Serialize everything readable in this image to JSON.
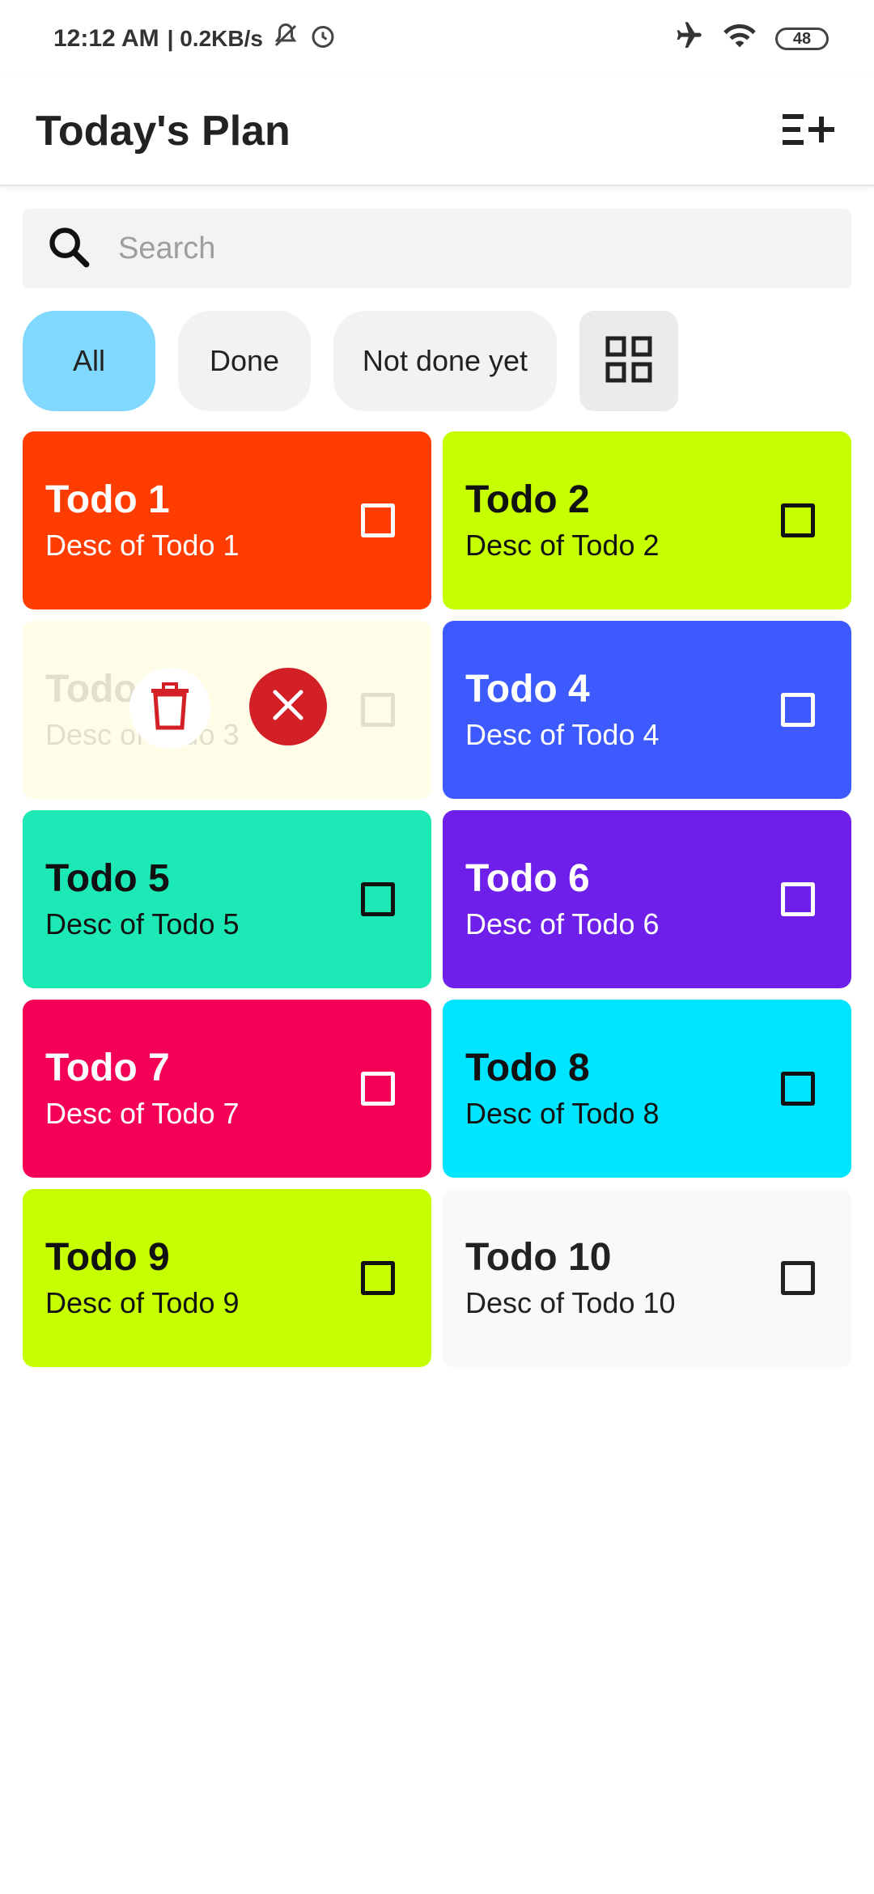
{
  "status_bar": {
    "time": "12:12 AM",
    "speed": "| 0.2KB/s",
    "battery": "48",
    "icons": [
      "mute-bell-icon",
      "alarm-icon",
      "airplane-icon",
      "wifi-icon",
      "battery-icon"
    ]
  },
  "appbar": {
    "title": "Today's Plan",
    "action_icon": "playlist-add-icon"
  },
  "search": {
    "placeholder": "Search",
    "value": ""
  },
  "filters": {
    "chips": [
      {
        "label": "All",
        "active": true
      },
      {
        "label": "Done",
        "active": false
      },
      {
        "label": "Not done yet",
        "active": false
      }
    ],
    "view_toggle_icon": "grid-view-icon"
  },
  "todos": [
    {
      "title": "Todo 1",
      "desc": "Desc of Todo 1",
      "color": "#ff3d00",
      "text_color": "#ffffff",
      "check_color": "#ffffff",
      "checked": false
    },
    {
      "title": "Todo 2",
      "desc": "Desc of Todo 2",
      "color": "#c6ff00",
      "text_color": "#111111",
      "check_color": "#111111",
      "checked": false
    },
    {
      "title": "Todo 3",
      "desc": "Desc of Todo 3",
      "color": "#fffde7",
      "text_color": "#111111",
      "check_color": "#111111",
      "checked": false,
      "selected": true
    },
    {
      "title": "Todo 4",
      "desc": "Desc of Todo 4",
      "color": "#3d5afe",
      "text_color": "#ffffff",
      "check_color": "#ffffff",
      "checked": false
    },
    {
      "title": "Todo 5",
      "desc": "Desc of Todo 5",
      "color": "#1de9b6",
      "text_color": "#111111",
      "check_color": "#111111",
      "checked": false
    },
    {
      "title": "Todo 6",
      "desc": "Desc of Todo 6",
      "color": "#6e20ea",
      "text_color": "#ffffff",
      "check_color": "#ffffff",
      "checked": false
    },
    {
      "title": "Todo 7",
      "desc": "Desc of Todo 7",
      "color": "#f50057",
      "text_color": "#ffffff",
      "check_color": "#ffffff",
      "checked": false
    },
    {
      "title": "Todo 8",
      "desc": "Desc of Todo 8",
      "color": "#00e5ff",
      "text_color": "#111111",
      "check_color": "#111111",
      "checked": false
    },
    {
      "title": "Todo 9",
      "desc": "Desc of Todo 9",
      "color": "#c6ff00",
      "text_color": "#111111",
      "check_color": "#111111",
      "checked": false
    },
    {
      "title": "Todo 10",
      "desc": "Desc of Todo 10",
      "color": "#f9f9f9",
      "text_color": "#222222",
      "check_color": "#222222",
      "checked": false
    }
  ],
  "selection_actions": {
    "delete_icon": "trash-icon",
    "cancel_icon": "close-icon",
    "delete_color": "#d32027"
  }
}
